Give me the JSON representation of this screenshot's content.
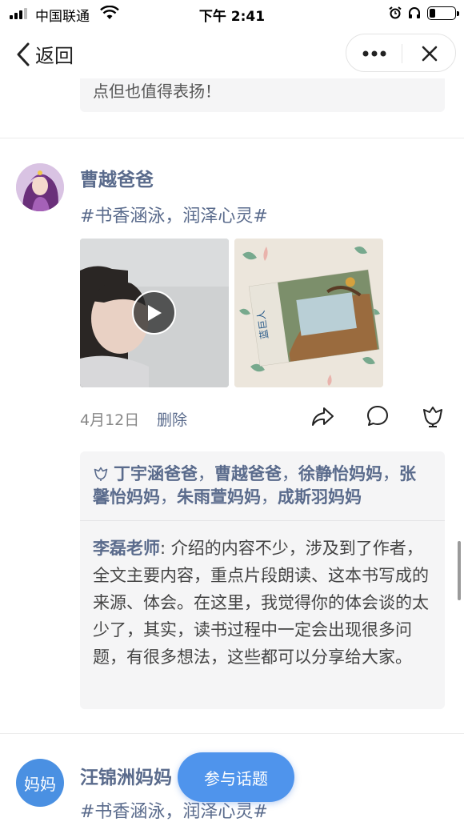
{
  "status_bar": {
    "carrier": "中国联通",
    "time": "下午 2:41",
    "battery_level": 0.25
  },
  "nav": {
    "back_label": "返回"
  },
  "previous_post": {
    "comment_tail": "点但也值得表扬！"
  },
  "post": {
    "author": "曹越爸爸",
    "topic": "#书香涵泳，润泽心灵#",
    "date": "4月12日",
    "delete_label": "删除",
    "likes": [
      "丁宇涵爸爸",
      "曹越爸爸",
      "徐静怡妈妈",
      "张馨怡妈妈",
      "朱雨萱妈妈",
      "成斯羽妈妈"
    ],
    "like_separator": "，",
    "comment": {
      "author": "李磊老师",
      "colon": ": ",
      "text": "介绍的内容不少，涉及到了作者，全文主要内容，重点片段朗读、这本书写成的来源、体会。在这里，我觉得你的体会谈的太少了，其实，读书过程中一定会出现很多问题，有很多想法，这些都可以分享给大家。"
    },
    "photo_book_title": "蓝巨人"
  },
  "next_post": {
    "avatar_text": "妈妈",
    "author": "汪锦洲妈妈",
    "topic": "#书香涵泳，润泽心灵#"
  },
  "join_button_label": "参与话题",
  "colors": {
    "link": "#5a6b8c",
    "accent": "#4f94ec",
    "comment_bg": "#f5f5f6"
  },
  "icons": [
    "signal-icon",
    "wifi-icon",
    "alarm-icon",
    "headphones-icon",
    "battery-icon",
    "back-chevron-icon",
    "more-dots-icon",
    "close-icon",
    "play-icon",
    "share-icon",
    "comment-icon",
    "like-icon"
  ]
}
